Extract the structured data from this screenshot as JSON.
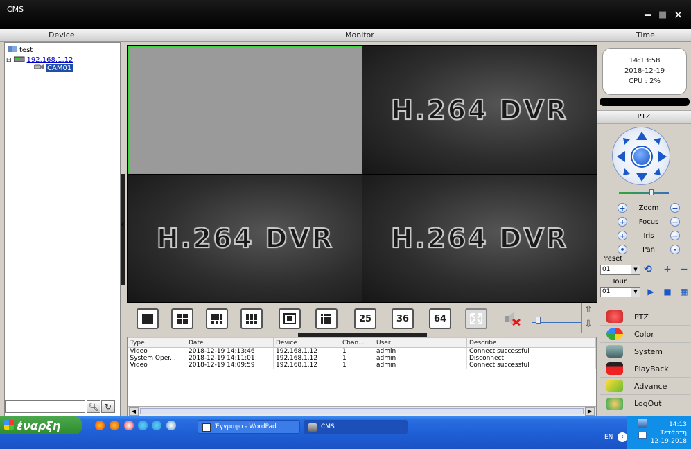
{
  "window": {
    "title": "CMS"
  },
  "header": {
    "device": "Device",
    "monitor": "Monitor",
    "time": "Time"
  },
  "tree": {
    "root": "test",
    "host": "192.168.1.12",
    "camera": "CAM01"
  },
  "video": {
    "watermark": "H.264 DVR"
  },
  "layout_buttons": {
    "b25": "25",
    "b36": "36",
    "b64": "64"
  },
  "log": {
    "columns": [
      "Type",
      "Date",
      "Device",
      "Chan...",
      "User",
      "Describe"
    ],
    "rows": [
      [
        "Video",
        "2018-12-19 14:13:46",
        "192.168.1.12",
        "1",
        "admin",
        "Connect successful"
      ],
      [
        "System Oper...",
        "2018-12-19 14:11:01",
        "192.168.1.12",
        "1",
        "admin",
        "Disconnect"
      ],
      [
        "Video",
        "2018-12-19 14:09:59",
        "192.168.1.12",
        "1",
        "admin",
        "Connect successful"
      ]
    ]
  },
  "status": {
    "time": "14:13:58",
    "date": "2018-12-19",
    "cpu": "CPU : 2%"
  },
  "ptz": {
    "title": "PTZ",
    "zoom": "Zoom",
    "focus": "Focus",
    "iris": "Iris",
    "pan": "Pan",
    "preset_label": "Preset",
    "preset_value": "01",
    "tour_label": "Tour",
    "tour_value": "01"
  },
  "nav": [
    "PTZ",
    "Color",
    "System",
    "PlayBack",
    "Advance",
    "LogOut"
  ],
  "taskbar": {
    "start": "έναρξη",
    "wordpad": "Έγγραφο - WordPad",
    "cms": "CMS",
    "lang": "EN",
    "clock_time": "14:13",
    "clock_day": "Τετάρτη",
    "clock_date": "12-19-2018"
  },
  "colors": {
    "selection_border": "#3cd43c",
    "taskbar_blue": "#1f5fd6",
    "accent_blue": "#1a57c8"
  }
}
